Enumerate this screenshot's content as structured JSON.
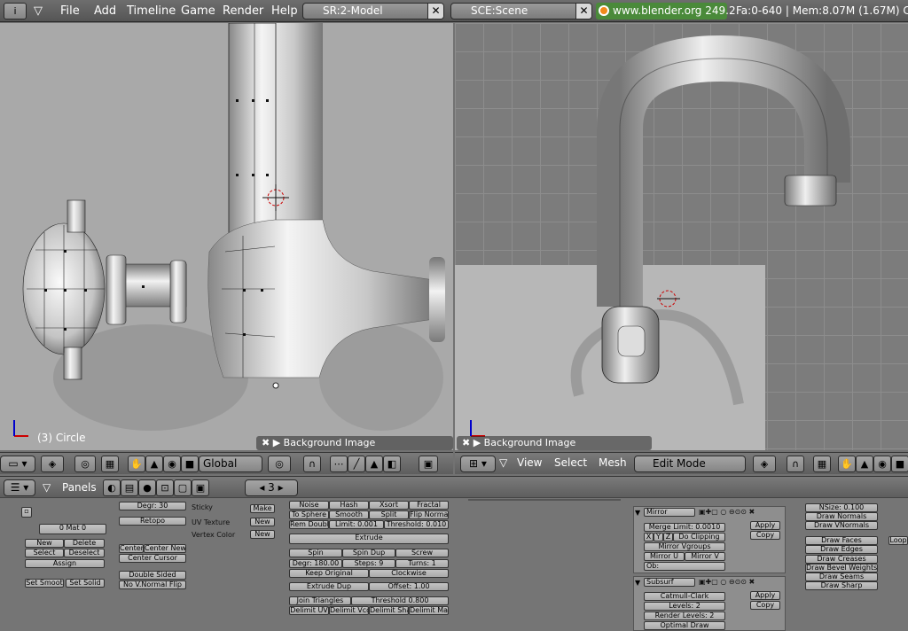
{
  "menubar": {
    "items": [
      "File",
      "Add",
      "Timeline",
      "Game",
      "Render",
      "Help"
    ],
    "screen": "SR:2-Model",
    "scene": "SCE:Scene",
    "url": "www.blender.org 249.2",
    "stats": "Fa:0-640 | Mem:8.07M (1.67M) C"
  },
  "left_view": {
    "object_label": "(3) Circle",
    "bg_image_label": "Background Image",
    "orientation": "Global"
  },
  "right_view": {
    "bg_image_label": "Background Image",
    "menus": [
      "View",
      "Select",
      "Mesh"
    ],
    "mode": "Edit Mode"
  },
  "buttons_header": {
    "panels_label": "Panels",
    "frame": "3"
  },
  "link_panel": {
    "mat_label": "0 Mat 0",
    "new": "New",
    "delete": "Delete",
    "select": "Select",
    "deselect": "Deselect",
    "assign": "Assign",
    "set_smooth": "Set Smoot",
    "set_solid": "Set Solid"
  },
  "mesh_panel": {
    "degr": "Degr: 30",
    "retopo": "Retopo",
    "sticky": "Sticky",
    "uv_texture": "UV Texture",
    "vertex_color": "Vertex Color",
    "make": "Make",
    "new1": "New",
    "new2": "New",
    "center": "Center",
    "center_new": "Center New",
    "center_cursor": "Center Cursor",
    "double_sided": "Double Sided",
    "no_vnormal_flip": "No V.Normal Flip"
  },
  "mesh_tools": {
    "noise": "Noise",
    "hash": "Hash",
    "xsort": "Xsort",
    "fractal": "Fractal",
    "to_sphere": "To Sphere",
    "smooth": "Smooth",
    "split": "Split",
    "flip_normal": "Flip Normal",
    "rem_doubl": "Rem Doubl",
    "limit": "Limit: 0.001",
    "threshold": "Threshold: 0.010",
    "extrude": "Extrude",
    "spin": "Spin",
    "spin_dup": "Spin Dup",
    "screw": "Screw",
    "degr_180": "Degr: 180.00",
    "steps": "Steps: 9",
    "turns": "Turns: 1",
    "keep_original": "Keep Original",
    "clockwise": "Clockwise",
    "extrude_dup": "Extrude Dup",
    "offset": "Offset: 1.00",
    "join_triangles": "Join Triangles",
    "threshold2": "Threshold 0.800",
    "delimit_uv": "Delimit UV",
    "delimit_vco": "Delimit Vco",
    "delimit_sha": "Delimit Sha",
    "delimit_ma": "Delimit Ma"
  },
  "modifiers": {
    "mirror": "Mirror",
    "merge_limit": "Merge Limit: 0.0010",
    "axes": [
      "X",
      "Y",
      "Z"
    ],
    "do_clipping": "Do Clipping",
    "mirror_vgroups": "Mirror Vgroups",
    "mirror_u": "Mirror U",
    "mirror_v": "Mirror V",
    "ob": "Ob:",
    "apply": "Apply",
    "copy": "Copy",
    "subsurf": "Subsurf",
    "catmull": "Catmull-Clark",
    "levels": "Levels: 2",
    "render_levels": "Render Levels: 2",
    "optimal_draw": "Optimal Draw",
    "apply2": "Apply",
    "copy2": "Copy"
  },
  "draw_panel": {
    "nsize": "NSize: 0.100",
    "draw_normals": "Draw Normals",
    "draw_vnormals": "Draw VNormals",
    "draw_faces": "Draw Faces",
    "draw_edges": "Draw Edges",
    "draw_creases": "Draw Creases",
    "draw_bevel": "Draw Bevel Weights",
    "draw_seams": "Draw Seams",
    "draw_sharp": "Draw Sharp",
    "loop": "Loop"
  }
}
